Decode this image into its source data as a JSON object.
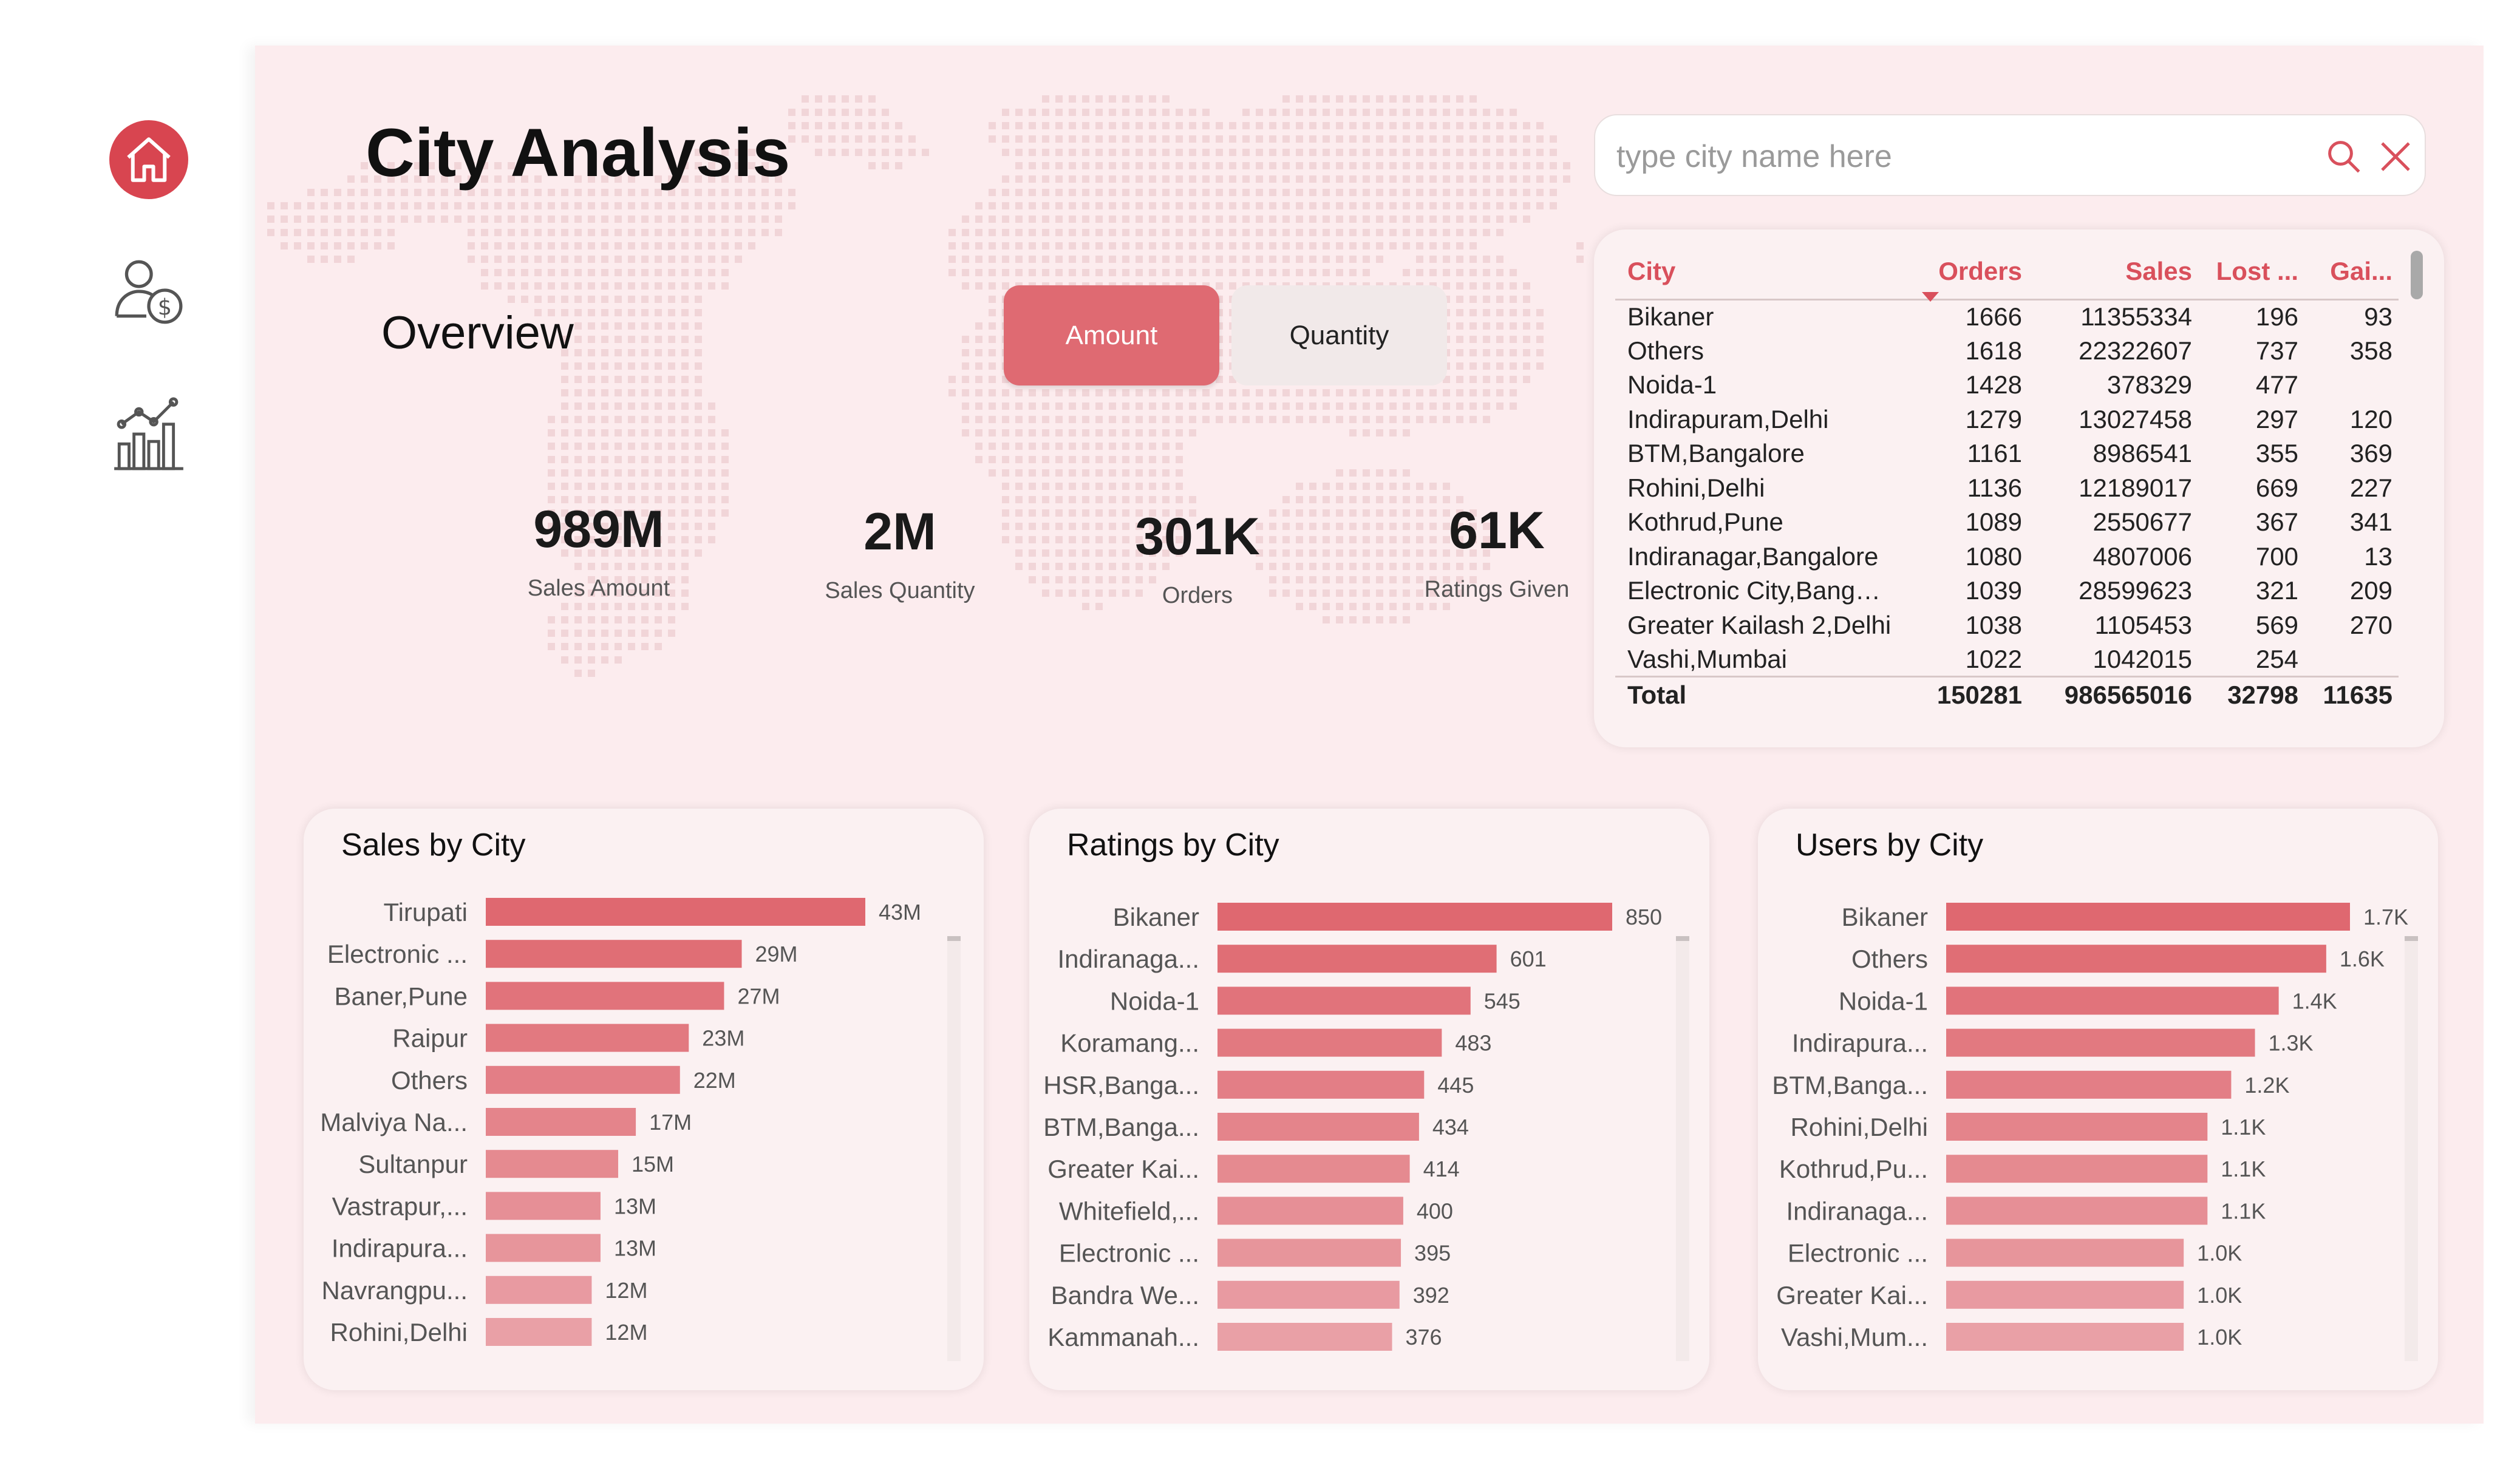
{
  "page": {
    "title": "City Analysis",
    "overview": "Overview"
  },
  "nav": [
    {
      "icon": "home-icon",
      "active": true
    },
    {
      "icon": "user-dollar-icon",
      "active": false
    },
    {
      "icon": "bar-chart-trend-icon",
      "active": false
    }
  ],
  "toggle": {
    "amount_label": "Amount",
    "quantity_label": "Quantity",
    "selected": "Amount"
  },
  "kpis": [
    {
      "value": "989M",
      "label": "Sales Amount"
    },
    {
      "value": "2M",
      "label": "Sales Quantity"
    },
    {
      "value": "301K",
      "label": "Orders"
    },
    {
      "value": "61K",
      "label": "Ratings Given"
    }
  ],
  "search": {
    "placeholder": "type city name here",
    "value": ""
  },
  "table": {
    "headers": [
      "City",
      "Orders",
      "Sales",
      "Lost ...",
      "Gai..."
    ],
    "sorted_by": "Orders",
    "sort_direction": "descending",
    "rows": [
      [
        "Bikaner",
        "1666",
        "11355334",
        "196",
        "93"
      ],
      [
        "Others",
        "1618",
        "22322607",
        "737",
        "358"
      ],
      [
        "Noida-1",
        "1428",
        "378329",
        "477",
        ""
      ],
      [
        "Indirapuram,Delhi",
        "1279",
        "13027458",
        "297",
        "120"
      ],
      [
        "BTM,Bangalore",
        "1161",
        "8986541",
        "355",
        "369"
      ],
      [
        "Rohini,Delhi",
        "1136",
        "12189017",
        "669",
        "227"
      ],
      [
        "Kothrud,Pune",
        "1089",
        "2550677",
        "367",
        "341"
      ],
      [
        "Indiranagar,Bangalore",
        "1080",
        "4807006",
        "700",
        "13"
      ],
      [
        "Electronic City,Bangal...",
        "1039",
        "28599623",
        "321",
        "209"
      ],
      [
        "Greater Kailash 2,Delhi",
        "1038",
        "1105453",
        "569",
        "270"
      ],
      [
        "Vashi,Mumbai",
        "1022",
        "1042015",
        "254",
        ""
      ]
    ],
    "total": [
      "Total",
      "150281",
      "986565016",
      "32798",
      "11635"
    ]
  },
  "colors": {
    "accent": "#df6a72",
    "bar_dark": "#df6870",
    "bar_light": "#e9a0a6",
    "background": "#fcecee",
    "header_text": "#d9505c"
  },
  "chart_data": [
    {
      "type": "bar",
      "orientation": "horizontal",
      "title": "Sales by City",
      "categories": [
        "Tirupati",
        "Electronic ...",
        "Baner,Pune",
        "Raipur",
        "Others",
        "Malviya Na...",
        "Sultanpur",
        "Vastrapur,...",
        "Indirapura...",
        "Navrangpu...",
        "Rohini,Delhi"
      ],
      "values": [
        43000000,
        29000000,
        27000000,
        23000000,
        22000000,
        17000000,
        15000000,
        13000000,
        13000000,
        12000000,
        12000000
      ],
      "data_labels": [
        "43M",
        "29M",
        "27M",
        "23M",
        "22M",
        "17M",
        "15M",
        "13M",
        "13M",
        "12M",
        "12M"
      ]
    },
    {
      "type": "bar",
      "orientation": "horizontal",
      "title": "Ratings by City",
      "categories": [
        "Bikaner",
        "Indiranaga...",
        "Noida-1",
        "Koramang...",
        "HSR,Banga...",
        "BTM,Banga...",
        "Greater Kai...",
        "Whitefield,...",
        "Electronic ...",
        "Bandra We...",
        "Kammanah..."
      ],
      "values": [
        850,
        601,
        545,
        483,
        445,
        434,
        414,
        400,
        395,
        392,
        376
      ],
      "data_labels": [
        "850",
        "601",
        "545",
        "483",
        "445",
        "434",
        "414",
        "400",
        "395",
        "392",
        "376"
      ]
    },
    {
      "type": "bar",
      "orientation": "horizontal",
      "title": "Users by City",
      "categories": [
        "Bikaner",
        "Others",
        "Noida-1",
        "Indirapura...",
        "BTM,Banga...",
        "Rohini,Delhi",
        "Kothrud,Pu...",
        "Indiranaga...",
        "Electronic ...",
        "Greater Kai...",
        "Vashi,Mum..."
      ],
      "values": [
        1700,
        1600,
        1400,
        1300,
        1200,
        1100,
        1100,
        1100,
        1000,
        1000,
        1000
      ],
      "data_labels": [
        "1.7K",
        "1.6K",
        "1.4K",
        "1.3K",
        "1.2K",
        "1.1K",
        "1.1K",
        "1.1K",
        "1.0K",
        "1.0K",
        "1.0K"
      ]
    }
  ]
}
